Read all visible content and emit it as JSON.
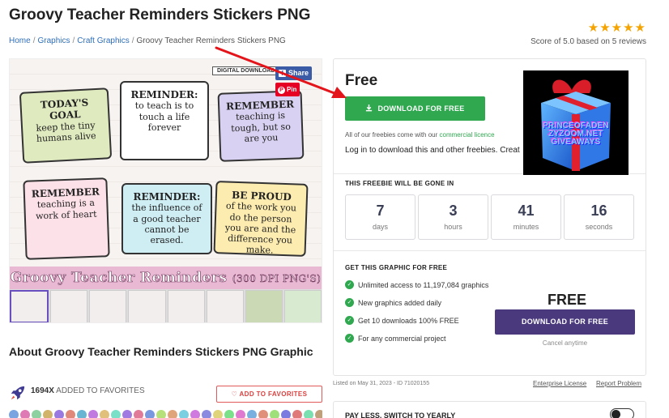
{
  "page": {
    "title": "Groovy Teacher Reminders Stickers PNG",
    "breadcrumb": [
      "Home",
      "Graphics",
      "Craft Graphics",
      "Groovy Teacher Reminders Stickers PNG"
    ],
    "rating": {
      "stars": "★★★★★",
      "text": "Score of 5.0 based on 5 reviews"
    }
  },
  "product_image": {
    "tab": "DIGITAL DOWNLOAD",
    "notes": [
      {
        "heading": "TODAY'S GOAL",
        "body": "keep the tiny humans alive"
      },
      {
        "heading": "REMINDER:",
        "body": "to teach is to touch a life forever"
      },
      {
        "heading": "REMEMBER",
        "body": "teaching is tough, but so are you"
      },
      {
        "heading": "REMEMBER",
        "body": "teaching is a work of heart"
      },
      {
        "heading": "REMINDER:",
        "body": "the influence of a good teacher cannot be erased."
      },
      {
        "heading": "BE PROUD",
        "body": "of the work you do the person you are and the difference you make."
      }
    ],
    "banner_title": "Groovy Teacher Reminders",
    "banner_sub": "(300 DPI PNG'S)"
  },
  "social": {
    "share": "Share",
    "pin": "Pin"
  },
  "about": {
    "heading": "About Groovy Teacher Reminders Stickers PNG Graphic",
    "favorites_count": "1694X",
    "favorites_text": "ADDED TO FAVORITES",
    "add_favorites": "ADD TO FAVORITES"
  },
  "panel": {
    "price_label": "Free",
    "download_label": "DOWNLOAD FOR FREE",
    "freebie_note_prefix": "All of our freebies come with our",
    "freebie_note_link": "commercial licence",
    "login_note": "Log in to download this and other freebies. Creat",
    "gone_heading": "THIS FREEBIE WILL BE GONE IN",
    "countdown": [
      {
        "value": "7",
        "unit": "days"
      },
      {
        "value": "3",
        "unit": "hours"
      },
      {
        "value": "41",
        "unit": "minutes"
      },
      {
        "value": "16",
        "unit": "seconds"
      }
    ],
    "get_heading": "GET THIS GRAPHIC FOR FREE",
    "benefits": [
      "Unlimited access to 11,197,084 graphics",
      "New graphics added daily",
      "Get 10 downloads 100% FREE",
      "For any commercial project"
    ],
    "big_free": "FREE",
    "download_label_2": "DOWNLOAD FOR FREE",
    "cancel_text": "Cancel anytime"
  },
  "footer": {
    "listed": "Listed on May 31, 2023 - ID 71020155",
    "enterprise": "Enterprise License",
    "report": "Report Problem",
    "pay_less": "PAY LESS, SWITCH TO YEARLY"
  },
  "overlay": {
    "ad_lines": [
      "PRINCEOFADEN",
      "ZYZOOM.NET",
      "GIVEAWAYS"
    ]
  },
  "colors": {
    "green": "#2fa84f",
    "purple": "#4a3a7d",
    "link_blue": "#2f6fba",
    "star": "#f5a300",
    "arrow_red": "#e4141b"
  }
}
